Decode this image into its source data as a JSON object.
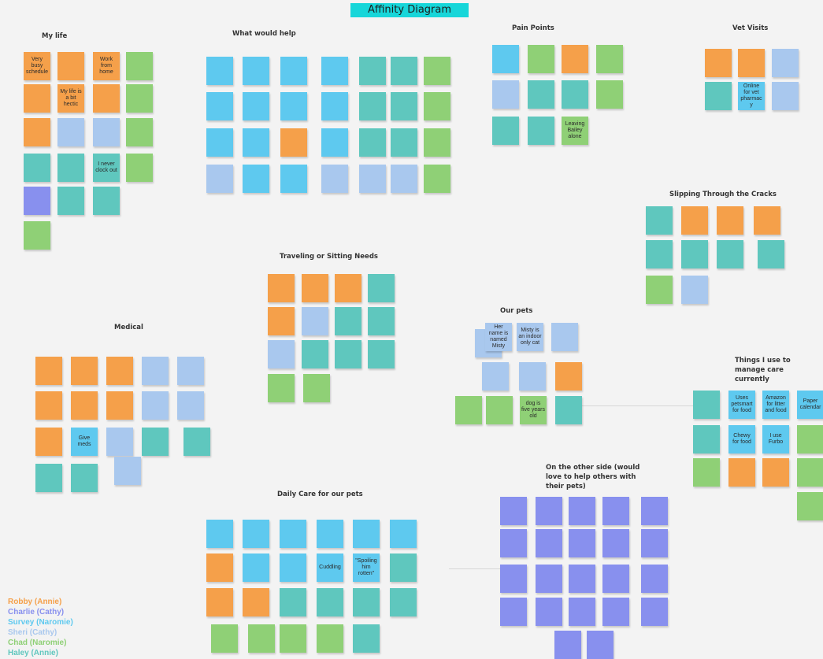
{
  "title": "Affinity Diagram",
  "colors": {
    "orange": "#f5a04a",
    "blue": "#5ec9ef",
    "lightblue": "#a9c8ee",
    "teal": "#5fc7be",
    "green": "#8fd076",
    "purple": "#8890ee"
  },
  "legend": [
    {
      "label": "Robby (Annie)",
      "color": "#f5a04a"
    },
    {
      "label": "Charlie (Cathy)",
      "color": "#8890ee"
    },
    {
      "label": "Survey (Naromie)",
      "color": "#5ec9ef"
    },
    {
      "label": "Sheri (Cathy)",
      "color": "#a9c8ee"
    },
    {
      "label": "Chad (Naromie)",
      "color": "#8fd076"
    },
    {
      "label": "Haley (Annie)",
      "color": "#5fc7be"
    }
  ],
  "groups": [
    {
      "id": "my-life",
      "title": "My life",
      "notes": [
        {
          "t": "Very busy schedule",
          "c": "orange",
          "big": true
        },
        {
          "t": "",
          "c": "orange"
        },
        {
          "t": "Work from home",
          "c": "orange",
          "big": true
        },
        {
          "t": "",
          "c": "green"
        },
        {
          "t": "",
          "c": "orange"
        },
        {
          "t": "My life is a bit hectic",
          "c": "orange",
          "big": true
        },
        {
          "t": "",
          "c": "orange"
        },
        {
          "t": "",
          "c": "green"
        },
        {
          "t": "",
          "c": "orange"
        },
        {
          "t": "",
          "c": "lightblue"
        },
        {
          "t": "",
          "c": "lightblue"
        },
        {
          "t": "",
          "c": "green"
        },
        {
          "t": "",
          "c": "teal"
        },
        {
          "t": "",
          "c": "teal"
        },
        {
          "t": "I never clock out",
          "c": "teal",
          "big": true
        },
        {
          "t": "",
          "c": "green"
        },
        {
          "t": "",
          "c": "purple"
        },
        {
          "t": "",
          "c": "teal"
        },
        {
          "t": "",
          "c": "teal"
        },
        {
          "t": "",
          "c": "green"
        }
      ]
    },
    {
      "id": "what-would-help",
      "title": "What would help",
      "notes": [
        {
          "t": "",
          "c": "blue"
        },
        {
          "t": "",
          "c": "blue"
        },
        {
          "t": "",
          "c": "blue"
        },
        {
          "t": "",
          "c": "blue"
        },
        {
          "t": "",
          "c": "teal"
        },
        {
          "t": "",
          "c": "teal"
        },
        {
          "t": "",
          "c": "green"
        },
        {
          "t": "",
          "c": "blue"
        },
        {
          "t": "",
          "c": "blue"
        },
        {
          "t": "",
          "c": "blue"
        },
        {
          "t": "",
          "c": "blue"
        },
        {
          "t": "",
          "c": "teal"
        },
        {
          "t": "",
          "c": "teal"
        },
        {
          "t": "",
          "c": "green"
        },
        {
          "t": "",
          "c": "blue"
        },
        {
          "t": "",
          "c": "blue"
        },
        {
          "t": "",
          "c": "orange"
        },
        {
          "t": "",
          "c": "blue"
        },
        {
          "t": "",
          "c": "teal"
        },
        {
          "t": "",
          "c": "teal"
        },
        {
          "t": "",
          "c": "green"
        },
        {
          "t": "",
          "c": "lightblue"
        },
        {
          "t": "",
          "c": "blue"
        },
        {
          "t": "",
          "c": "blue"
        },
        {
          "t": "",
          "c": "lightblue"
        },
        {
          "t": "",
          "c": "lightblue"
        },
        {
          "t": "",
          "c": "lightblue"
        },
        {
          "t": "",
          "c": "green"
        }
      ]
    },
    {
      "id": "pain-points",
      "title": "Pain Points",
      "notes": [
        {
          "t": "",
          "c": "blue"
        },
        {
          "t": "",
          "c": "green"
        },
        {
          "t": "",
          "c": "orange"
        },
        {
          "t": "",
          "c": "green"
        },
        {
          "t": "",
          "c": "lightblue"
        },
        {
          "t": "",
          "c": "teal"
        },
        {
          "t": "",
          "c": "teal"
        },
        {
          "t": "",
          "c": "green"
        },
        {
          "t": "",
          "c": "teal"
        },
        {
          "t": "",
          "c": "teal"
        },
        {
          "t": "Leaving Bailey alone",
          "c": "green",
          "big": true
        }
      ]
    },
    {
      "id": "vet-visits",
      "title": "Vet Visits",
      "notes": [
        {
          "t": "",
          "c": "orange"
        },
        {
          "t": "",
          "c": "orange"
        },
        {
          "t": "",
          "c": "lightblue"
        },
        {
          "t": "",
          "c": "teal"
        },
        {
          "t": "Online for vet pharmacy",
          "c": "blue",
          "big": true
        },
        {
          "t": "",
          "c": "lightblue"
        }
      ]
    },
    {
      "id": "slipping",
      "title": "Slipping Through the Cracks",
      "notes": [
        {
          "t": "",
          "c": "teal"
        },
        {
          "t": "",
          "c": "orange"
        },
        {
          "t": "",
          "c": "orange"
        },
        {
          "t": "",
          "c": "orange"
        },
        {
          "t": "",
          "c": "teal"
        },
        {
          "t": "",
          "c": "teal"
        },
        {
          "t": "",
          "c": "teal"
        },
        {
          "t": "",
          "c": "teal"
        },
        {
          "t": "",
          "c": "green"
        },
        {
          "t": "",
          "c": "lightblue"
        }
      ]
    },
    {
      "id": "traveling",
      "title": "Traveling or Sitting Needs",
      "notes": [
        {
          "t": "",
          "c": "orange"
        },
        {
          "t": "",
          "c": "orange"
        },
        {
          "t": "",
          "c": "orange"
        },
        {
          "t": "",
          "c": "teal"
        },
        {
          "t": "",
          "c": "orange"
        },
        {
          "t": "",
          "c": "lightblue"
        },
        {
          "t": "",
          "c": "teal"
        },
        {
          "t": "",
          "c": "teal"
        },
        {
          "t": "",
          "c": "lightblue"
        },
        {
          "t": "",
          "c": "teal"
        },
        {
          "t": "",
          "c": "teal"
        },
        {
          "t": "",
          "c": "teal"
        },
        {
          "t": "",
          "c": "green"
        },
        {
          "t": "",
          "c": "green"
        }
      ]
    },
    {
      "id": "our-pets",
      "title": "Our pets",
      "notes": [
        {
          "t": "",
          "c": "lightblue"
        },
        {
          "t": "Her name is named Misty",
          "c": "lightblue",
          "big": true
        },
        {
          "t": "Misty is an indoor only cat",
          "c": "lightblue",
          "big": true
        },
        {
          "t": "",
          "c": "lightblue"
        },
        {
          "t": "",
          "c": "lightblue"
        },
        {
          "t": "",
          "c": "lightblue"
        },
        {
          "t": "",
          "c": "orange"
        },
        {
          "t": "",
          "c": "green"
        },
        {
          "t": "",
          "c": "green"
        },
        {
          "t": "dog is five years old",
          "c": "green",
          "big": true
        },
        {
          "t": "",
          "c": "teal"
        }
      ]
    },
    {
      "id": "medical",
      "title": "Medical",
      "notes": [
        {
          "t": "",
          "c": "orange"
        },
        {
          "t": "",
          "c": "orange"
        },
        {
          "t": "",
          "c": "orange"
        },
        {
          "t": "",
          "c": "lightblue"
        },
        {
          "t": "",
          "c": "lightblue"
        },
        {
          "t": "",
          "c": "orange"
        },
        {
          "t": "",
          "c": "orange"
        },
        {
          "t": "",
          "c": "orange"
        },
        {
          "t": "",
          "c": "lightblue"
        },
        {
          "t": "",
          "c": "lightblue"
        },
        {
          "t": "",
          "c": "orange"
        },
        {
          "t": "Give meds",
          "c": "blue",
          "big": true
        },
        {
          "t": "",
          "c": "lightblue"
        },
        {
          "t": "",
          "c": "teal"
        },
        {
          "t": "",
          "c": "teal"
        },
        {
          "t": "",
          "c": "teal"
        },
        {
          "t": "",
          "c": "teal"
        },
        {
          "t": "",
          "c": "lightblue"
        }
      ]
    },
    {
      "id": "manage-care",
      "title": "Things I use to manage care currently",
      "notes": [
        {
          "t": "",
          "c": "teal"
        },
        {
          "t": "Uses petsmart for food",
          "c": "blue",
          "big": true
        },
        {
          "t": "Amazon for litter and food",
          "c": "blue",
          "big": true
        },
        {
          "t": "Paper calendar",
          "c": "blue",
          "big": true
        },
        {
          "t": "",
          "c": "teal"
        },
        {
          "t": "Chewy for food",
          "c": "blue",
          "big": true
        },
        {
          "t": "I use Furbo",
          "c": "blue",
          "big": true
        },
        {
          "t": "",
          "c": "green"
        },
        {
          "t": "",
          "c": "green"
        },
        {
          "t": "",
          "c": "orange"
        },
        {
          "t": "",
          "c": "orange"
        },
        {
          "t": "",
          "c": "green"
        },
        {
          "t": "",
          "c": "green"
        }
      ]
    },
    {
      "id": "other-side",
      "title": "On the other side (would love to help others with their pets)",
      "notes": [
        {
          "t": "",
          "c": "purple"
        },
        {
          "t": "",
          "c": "purple"
        },
        {
          "t": "",
          "c": "purple"
        },
        {
          "t": "",
          "c": "purple"
        },
        {
          "t": "",
          "c": "purple"
        },
        {
          "t": "",
          "c": "purple"
        },
        {
          "t": "",
          "c": "purple"
        },
        {
          "t": "",
          "c": "purple"
        },
        {
          "t": "",
          "c": "purple"
        },
        {
          "t": "",
          "c": "purple"
        },
        {
          "t": "",
          "c": "purple"
        },
        {
          "t": "",
          "c": "purple"
        },
        {
          "t": "",
          "c": "purple"
        },
        {
          "t": "",
          "c": "purple"
        },
        {
          "t": "",
          "c": "purple"
        },
        {
          "t": "",
          "c": "purple"
        },
        {
          "t": "",
          "c": "purple"
        },
        {
          "t": "",
          "c": "purple"
        },
        {
          "t": "",
          "c": "purple"
        },
        {
          "t": "",
          "c": "purple"
        },
        {
          "t": "",
          "c": "purple"
        },
        {
          "t": "",
          "c": "purple"
        }
      ]
    },
    {
      "id": "daily-care",
      "title": "Daily Care for our pets",
      "notes": [
        {
          "t": "",
          "c": "blue"
        },
        {
          "t": "",
          "c": "blue"
        },
        {
          "t": "",
          "c": "blue"
        },
        {
          "t": "",
          "c": "blue"
        },
        {
          "t": "",
          "c": "blue"
        },
        {
          "t": "",
          "c": "blue"
        },
        {
          "t": "",
          "c": "orange"
        },
        {
          "t": "",
          "c": "blue"
        },
        {
          "t": "",
          "c": "blue"
        },
        {
          "t": "Cuddling",
          "c": "blue",
          "big": true
        },
        {
          "t": "\"Spoiling him rotten\"",
          "c": "blue",
          "big": true
        },
        {
          "t": "",
          "c": "teal"
        },
        {
          "t": "",
          "c": "orange"
        },
        {
          "t": "",
          "c": "orange"
        },
        {
          "t": "",
          "c": "teal"
        },
        {
          "t": "",
          "c": "teal"
        },
        {
          "t": "",
          "c": "teal"
        },
        {
          "t": "",
          "c": "teal"
        },
        {
          "t": "",
          "c": "green"
        },
        {
          "t": "",
          "c": "green"
        },
        {
          "t": "",
          "c": "green"
        },
        {
          "t": "",
          "c": "green"
        },
        {
          "t": "",
          "c": "teal"
        }
      ]
    }
  ]
}
